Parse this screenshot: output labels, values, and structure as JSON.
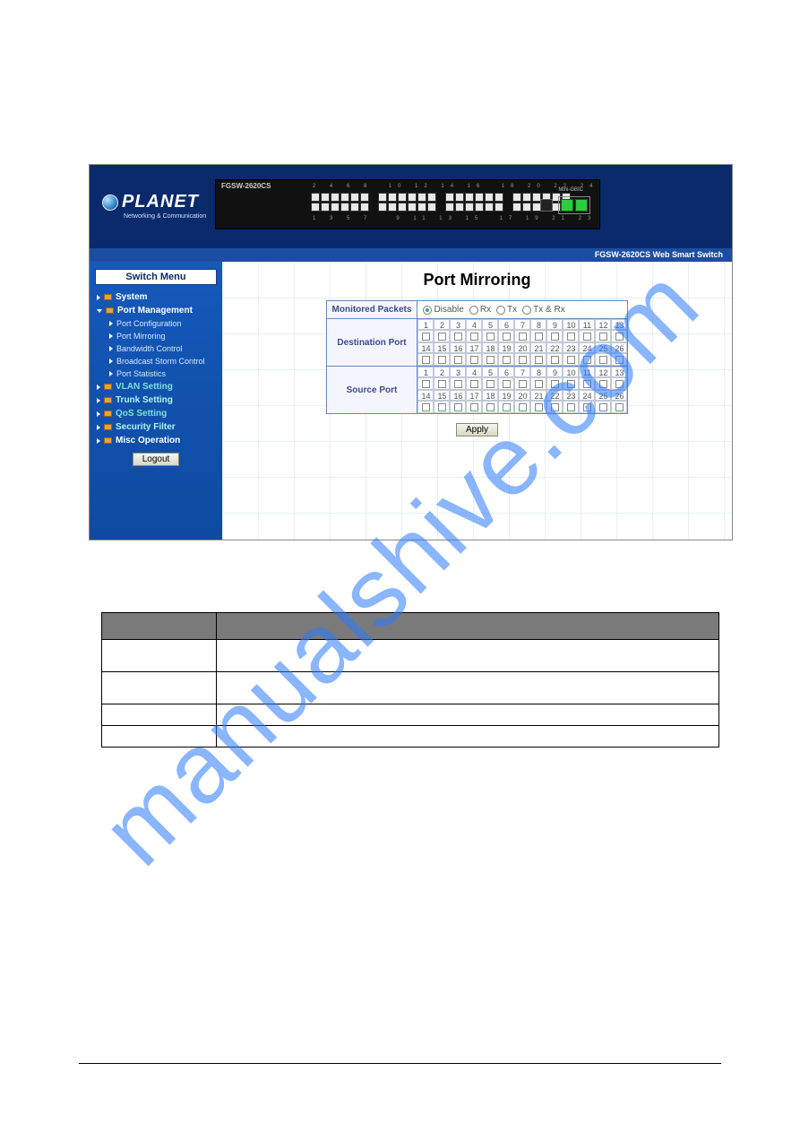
{
  "watermark": "manualshive.com",
  "banner": {
    "brand_name": "PLANET",
    "brand_tagline": "Networking & Communication",
    "device_model": "FGSW-2620CS",
    "gbic_label": "Mini-GBIC",
    "strip_text": "FGSW-2620CS Web Smart Switch"
  },
  "sidebar": {
    "menu_title": "Switch Menu",
    "items": {
      "system": "System",
      "port_management": "Port Management",
      "port_configuration": "Port Configuration",
      "port_mirroring": "Port Mirroring",
      "bandwidth_control": "Bandwidth Control",
      "broadcast_storm": "Broadcast Storm Control",
      "port_statistics": "Port Statistics",
      "vlan_setting": "VLAN Setting",
      "trunk_setting": "Trunk Setting",
      "qos_setting": "QoS Setting",
      "security_filter": "Security Filter",
      "misc_operation": "Misc Operation"
    },
    "logout_label": "Logout"
  },
  "content": {
    "page_title": "Port Mirroring",
    "rows": {
      "monitored": "Monitored Packets",
      "destination": "Destination Port",
      "source": "Source Port"
    },
    "radios": {
      "disable": "Disable",
      "rx": "Rx",
      "tx": "Tx",
      "txrx": "Tx & Rx"
    },
    "ports_row1": [
      "1",
      "2",
      "3",
      "4",
      "5",
      "6",
      "7",
      "8",
      "9",
      "10",
      "11",
      "12",
      "13"
    ],
    "ports_row2": [
      "14",
      "15",
      "16",
      "17",
      "18",
      "19",
      "20",
      "21",
      "22",
      "23",
      "24",
      "25",
      "26"
    ],
    "apply_label": "Apply"
  },
  "desc_table": {
    "headers": [
      "",
      ""
    ]
  }
}
